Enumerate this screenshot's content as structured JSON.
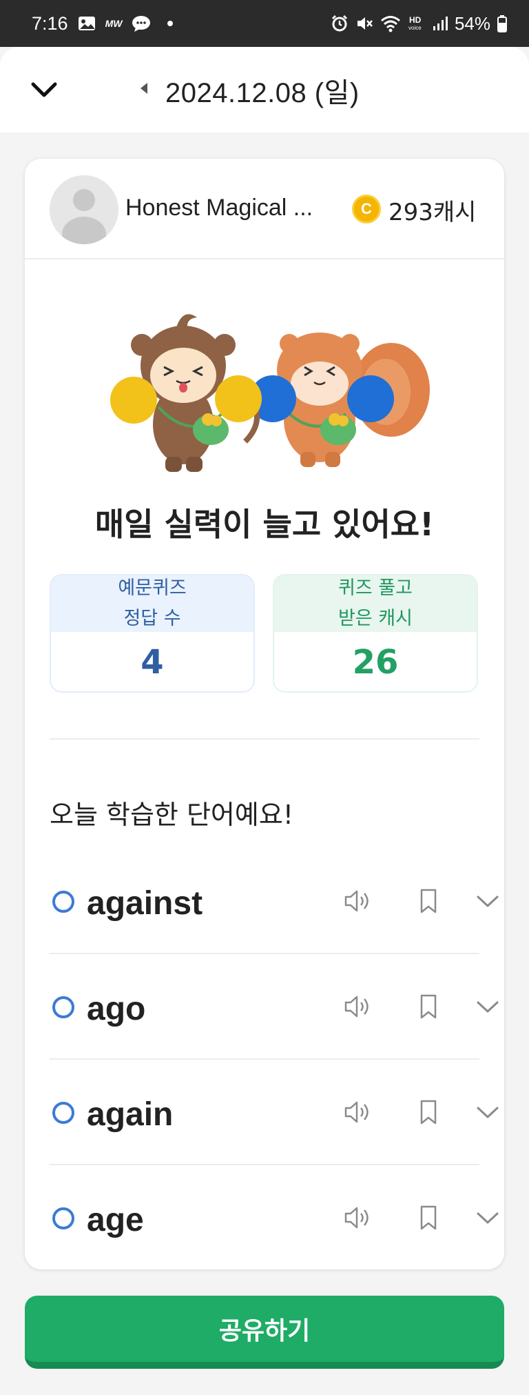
{
  "status_bar": {
    "time": "7:16",
    "battery": "54%",
    "app_badge": "MW"
  },
  "header": {
    "date": "2024.12.08 (일)"
  },
  "profile": {
    "name": "Honest Magical ...",
    "coin_symbol": "C",
    "cash": "293캐시"
  },
  "headline": "매일 실력이 늘고 있어요!",
  "stats": {
    "quiz": {
      "label_line1": "예문퀴즈",
      "label_line2": "정답 수",
      "value": "4"
    },
    "cash": {
      "label_line1": "퀴즈 풀고",
      "label_line2": "받은 캐시",
      "value": "26"
    }
  },
  "section_title": "오늘 학습한 단어예요!",
  "words": [
    {
      "word": "against"
    },
    {
      "word": "ago"
    },
    {
      "word": "again"
    },
    {
      "word": "age"
    }
  ],
  "share_button": "공유하기",
  "icons": {
    "back": "chevron-down-icon",
    "prev": "caret-left-icon",
    "sound": "speaker-icon",
    "bookmark": "bookmark-icon",
    "expand": "chevron-down-icon"
  },
  "colors": {
    "accent_green": "#1eac66",
    "accent_blue": "#2f5fa3",
    "word_circle": "#3b7bd4"
  }
}
